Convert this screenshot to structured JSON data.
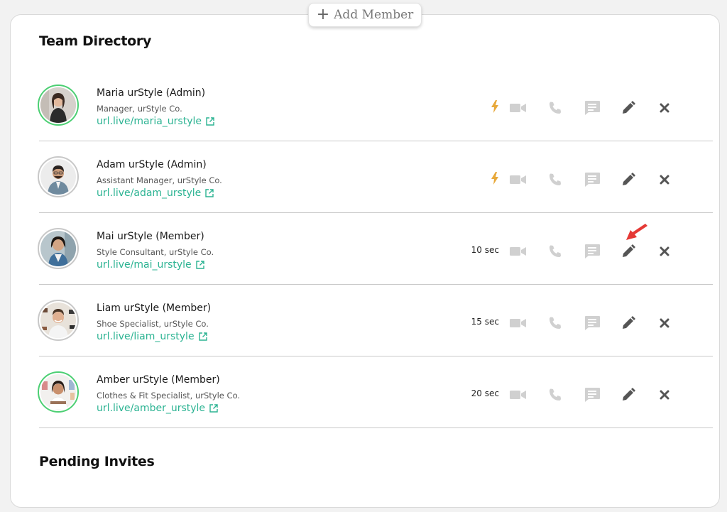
{
  "add_member_label": "Add Member",
  "sections": {
    "team_directory": "Team Directory",
    "pending_invites": "Pending Invites"
  },
  "colors": {
    "link": "#2bb392",
    "online_ring": "#4ccf73",
    "offline_ring": "#c8c8c8",
    "lightning": "#e8a93b",
    "pointer_arrow": "#e53935",
    "icon_disabled": "#cfcfcf",
    "icon_active": "#555555"
  },
  "members": [
    {
      "name": "Maria urStyle (Admin)",
      "role": "Manager, urStyle Co.",
      "link": "url.live/maria_urstyle",
      "status": "",
      "status_icon": "lightning-icon",
      "online": true
    },
    {
      "name": "Adam urStyle (Admin)",
      "role": "Assistant Manager, urStyle Co.",
      "link": "url.live/adam_urstyle",
      "status": "",
      "status_icon": "lightning-icon",
      "online": false
    },
    {
      "name": "Mai urStyle (Member)",
      "role": "Style Consultant, urStyle Co.",
      "link": "url.live/mai_urstyle",
      "status": "10 sec",
      "status_icon": "",
      "online": false
    },
    {
      "name": "Liam urStyle (Member)",
      "role": "Shoe Specialist, urStyle Co.",
      "link": "url.live/liam_urstyle",
      "status": "15 sec",
      "status_icon": "",
      "online": false
    },
    {
      "name": "Amber urStyle (Member)",
      "role": "Clothes & Fit Specialist, urStyle Co.",
      "link": "url.live/amber_urstyle",
      "status": "20 sec",
      "status_icon": "",
      "online": true
    }
  ]
}
